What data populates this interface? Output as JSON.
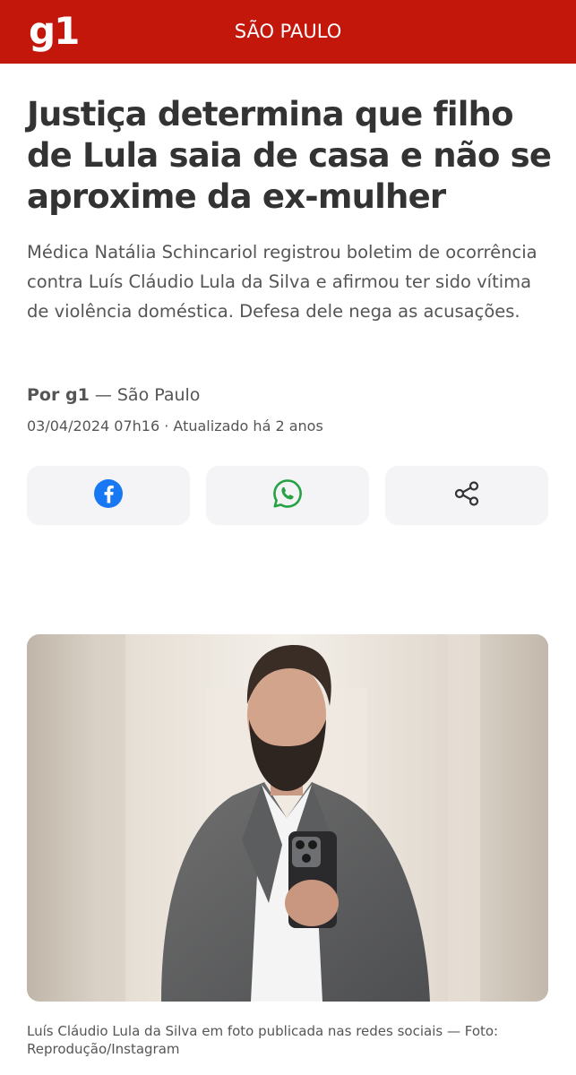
{
  "header": {
    "logo": "g1",
    "section": "SÃO PAULO"
  },
  "article": {
    "headline": "Justiça determina que filho de Lula saia de casa e não se aproxime da ex-mulher",
    "subtitle": "Médica Natália Schincariol registrou boletim de ocorrência contra Luís Cláudio Lula da Silva e afirmou ter sido vítima de violência doméstica. Defesa dele nega as acusações.",
    "byline_author": "Por g1",
    "byline_location": " — São Paulo",
    "dateline": "03/04/2024 07h16 · Atualizado há 2 anos"
  },
  "share": {
    "facebook_icon": "facebook-icon",
    "whatsapp_icon": "whatsapp-icon",
    "share_icon": "share-icon",
    "facebook_color": "#1877f2",
    "whatsapp_color": "#25a244"
  },
  "photo": {
    "caption": "Luís Cláudio Lula da Silva em foto publicada nas redes sociais — Foto: Reprodução/Instagram"
  },
  "colors": {
    "brand_red": "#c4170c",
    "text_dark": "#333333",
    "text_muted": "#555555"
  }
}
